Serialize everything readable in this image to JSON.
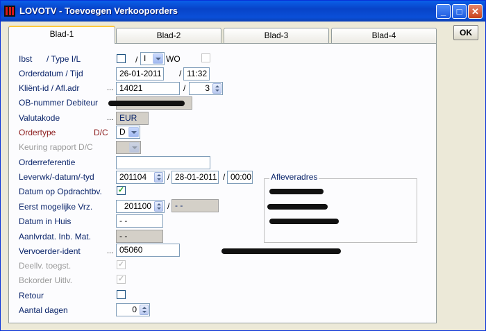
{
  "window": {
    "title": "LOVOTV - Toevoegen Verkooporders",
    "minimize": "_",
    "maximize": "□",
    "close": "✕"
  },
  "tabs": [
    "Blad-1",
    "Blad-2",
    "Blad-3",
    "Blad-4"
  ],
  "ok_label": "OK",
  "form": {
    "ibst_label": "Ibst",
    "type_label": "/ Type I/L",
    "type_value": "I",
    "wo_label": "WO",
    "orderdatum_label": "Orderdatum / Tijd",
    "orderdatum": "26-01-2011",
    "ordertijd": "11:32",
    "klient_label": "Kliënt-id / Afl.adr",
    "klient_id": "14021",
    "afl_adr": "3",
    "ob_label": "OB-nummer Debiteur",
    "valuta_label": "Valutakode",
    "valuta": "EUR",
    "ordertype_label": "Ordertype",
    "dc_label": "D/C",
    "ordertype": "D",
    "keuring_label": "Keuring rapport D/C",
    "orderref_label": "Orderreferentie",
    "orderref": "",
    "leverwk_label": "Leverwk/-datum/-tyd",
    "leverwk": "201104",
    "leverdatum": "28-01-2011",
    "levertijd": "00:00",
    "datum_op_label": "Datum op Opdrachtbv.",
    "eerst_label": "Eerst mogelijke Vrz.",
    "eerst_week": "201100",
    "eerst_datum": "- -",
    "datum_huis_label": "Datum in Huis",
    "datum_huis": "- -",
    "aanlvrdat_label": "Aanlvrdat. Inb. Mat.",
    "aanlvrdat": "- -",
    "vervoerder_label": "Vervoerder-ident",
    "vervoerder": "05060",
    "deellv_label": "Deellv. toegst.",
    "bckorder_label": "Bckorder Uitlv.",
    "retour_label": "Retour",
    "aantal_label": "Aantal dagen",
    "aantal": "0",
    "afleveradres_label": "Afleveradres",
    "sep_slash": "/",
    "dots": "..."
  }
}
